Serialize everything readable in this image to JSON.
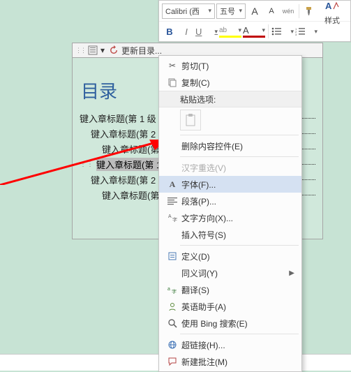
{
  "miniToolbar": {
    "fontName": "Calibri (西",
    "fontSize": "五号",
    "growFont": "A",
    "shrinkFont": "A",
    "phonetic": "wén",
    "bold": "B",
    "italic": "I",
    "underline": "U",
    "highlight": "ab",
    "fontColor": "A",
    "stylesLabel": "样式"
  },
  "tocBar": {
    "icon": "⟳",
    "label": "更新目录..."
  },
  "doc": {
    "title": "目录",
    "lines": [
      {
        "level": 1,
        "text": "键入章标题(第 1 级",
        "selected": false
      },
      {
        "level": 2,
        "text": "键入章标题(第 2",
        "selected": false
      },
      {
        "level": 3,
        "text": "键入章标题(第",
        "selected": false
      },
      {
        "level": 1,
        "text": "键入章标题(第 1 级",
        "selected": true
      },
      {
        "level": 2,
        "text": "键入章标题(第 2",
        "selected": false
      },
      {
        "level": 3,
        "text": "键入章标题(第",
        "selected": false
      }
    ]
  },
  "ctx": {
    "cut": "剪切(T)",
    "copy": "复制(C)",
    "pasteHeader": "粘贴选项:",
    "deleteCtrl": "删除内容控件(E)",
    "hanzi": "汉字重选(V)",
    "font": "字体(F)...",
    "paragraph": "段落(P)...",
    "textDir": "文字方向(X)...",
    "symbol": "插入符号(S)",
    "define": "定义(D)",
    "synonym": "同义词(Y)",
    "translate": "翻译(S)",
    "engAssist": "英语助手(A)",
    "bing": "使用 Bing 搜索(E)",
    "hyperlink": "超链接(H)...",
    "comment": "新建批注(M)"
  }
}
